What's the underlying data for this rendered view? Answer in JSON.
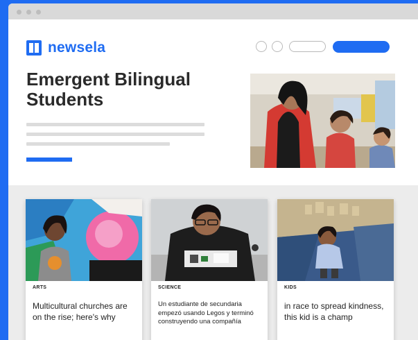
{
  "brand": {
    "name": "newsela",
    "color": "#1f6cf2"
  },
  "page": {
    "title": "Emergent Bilingual Students"
  },
  "articles": [
    {
      "tag": "ARTS",
      "title": "Multicultural churches are on the rise; here's why"
    },
    {
      "tag": "SCIENCE",
      "title": "Un estudiante de secundaria empezó usando Legos y terminó construyendo una compañía"
    },
    {
      "tag": "KIDS",
      "title": "in race to spread kindness, this kid is a champ"
    }
  ]
}
